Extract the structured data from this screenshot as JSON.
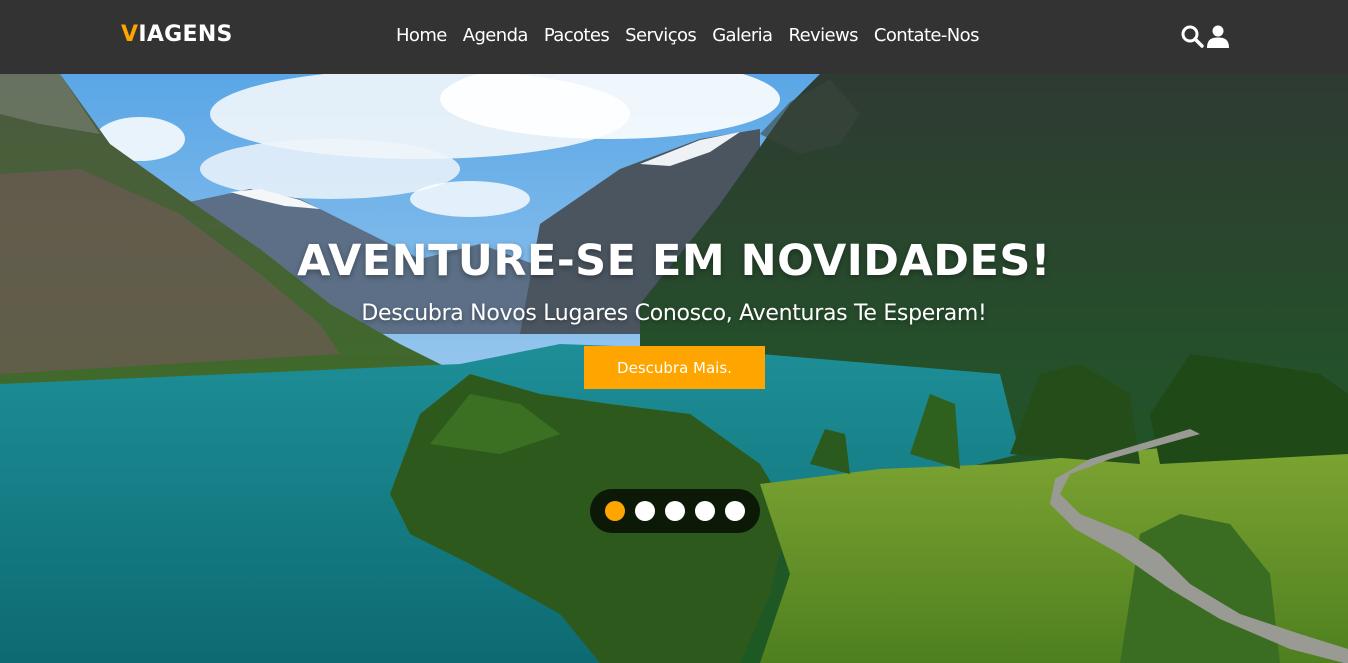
{
  "header": {
    "logo_first_letter": "V",
    "logo_rest": "IAGENS",
    "nav": [
      {
        "label": "Home"
      },
      {
        "label": "Agenda"
      },
      {
        "label": "Pacotes"
      },
      {
        "label": "Serviços"
      },
      {
        "label": "Galeria"
      },
      {
        "label": "Reviews"
      },
      {
        "label": "Contate-Nos"
      }
    ],
    "icons": [
      "search-icon",
      "user-icon"
    ]
  },
  "hero": {
    "title": "AVENTURE-SE EM NOVIDADES!",
    "subtitle": "Descubra Novos Lugares Conosco, Aventuras Te Esperam!",
    "cta_label": "Descubra Mais.",
    "slides_count": 5,
    "active_slide": 1
  },
  "colors": {
    "header_bg": "#333333",
    "accent": "#ffa500",
    "text": "#ffffff"
  }
}
